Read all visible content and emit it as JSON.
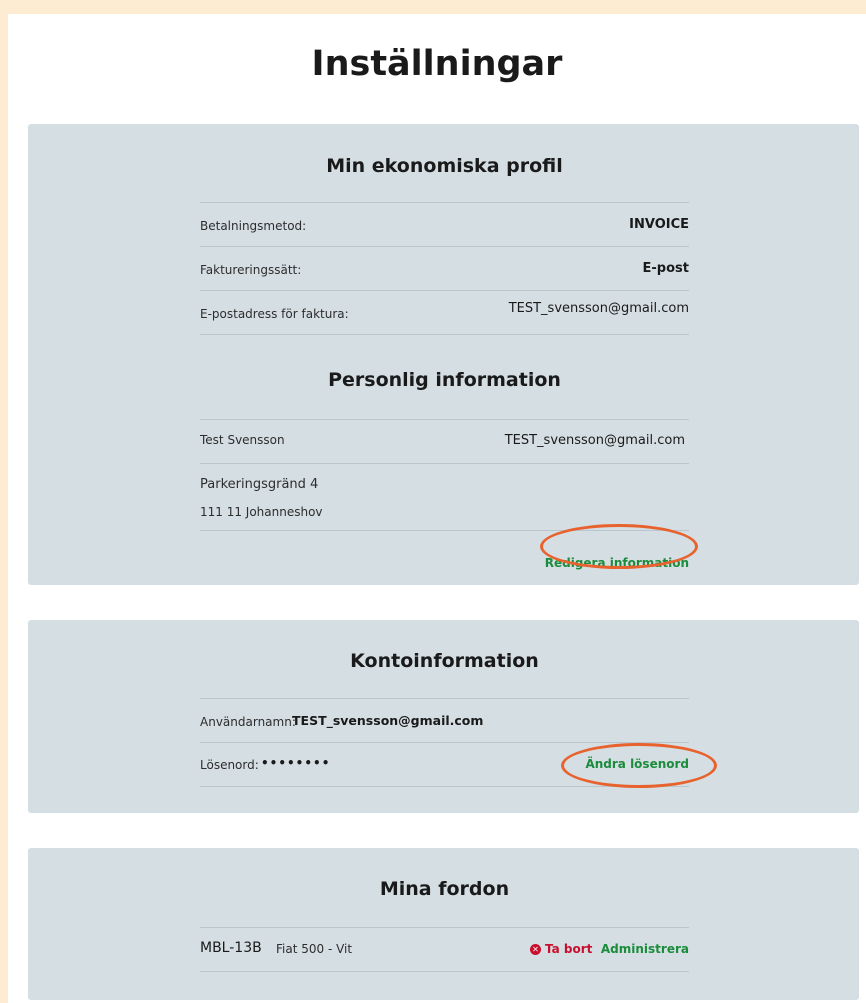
{
  "page": {
    "title": "Inställningar"
  },
  "economic_profile": {
    "title": "Min ekonomiska profil",
    "payment_method": {
      "label": "Betalningsmetod:",
      "value": "INVOICE"
    },
    "billing_method": {
      "label": "Faktureringssätt:",
      "value": "E-post"
    },
    "invoice_email": {
      "label": "E-postadress för faktura:",
      "value": "TEST_svensson@gmail.com"
    }
  },
  "personal_info": {
    "title": "Personlig information",
    "name": "Test Svensson",
    "email": "TEST_svensson@gmail.com",
    "street": "Parkeringsgränd 4",
    "postal": "111 11 Johanneshov",
    "edit_link": "Redigera information"
  },
  "account_info": {
    "title": "Kontoinformation",
    "username_label": "Användarnamn:",
    "username_value": "TEST_svensson@gmail.com",
    "password_label": "Lösenord:",
    "password_value": "••••••••",
    "change_password_link": "Ändra lösenord"
  },
  "vehicles": {
    "title": "Mina fordon",
    "items": [
      {
        "plate": "MBL-13B",
        "model": "Fiat 500 - Vit",
        "remove_label": "Ta bort",
        "manage_label": "Administrera"
      }
    ]
  },
  "colors": {
    "accent_green": "#1b8c3c",
    "danger_red": "#c8102e",
    "highlight_orange": "#e8622e",
    "panel_bg": "#d5dee3",
    "page_bg": "#fdebd2"
  },
  "icons": {
    "remove": "x-circle-icon"
  }
}
